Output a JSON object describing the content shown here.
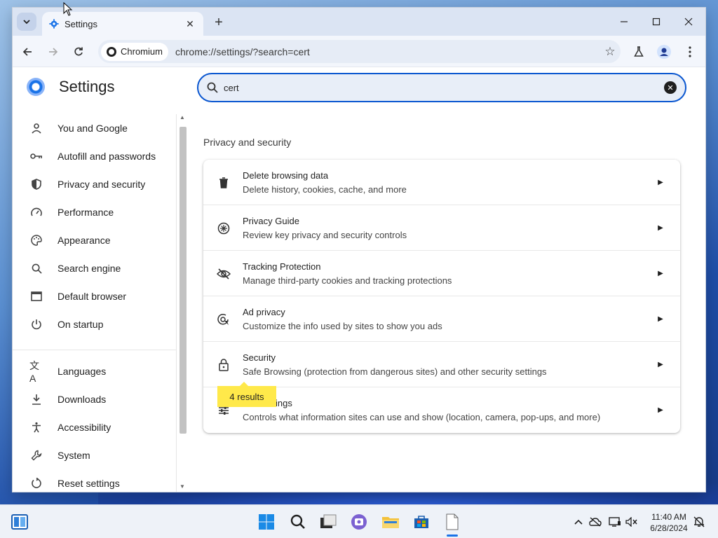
{
  "browser": {
    "tab_title": "Settings",
    "chip_label": "Chromium",
    "url": "chrome://settings/?search=cert"
  },
  "settings": {
    "title": "Settings",
    "search_value": "cert",
    "section_title": "Privacy and security",
    "results_badge": "4 results",
    "nav": [
      {
        "label": "You and Google",
        "icon": "person-icon"
      },
      {
        "label": "Autofill and passwords",
        "icon": "key-icon"
      },
      {
        "label": "Privacy and security",
        "icon": "shield-icon"
      },
      {
        "label": "Performance",
        "icon": "speedometer-icon"
      },
      {
        "label": "Appearance",
        "icon": "palette-icon"
      },
      {
        "label": "Search engine",
        "icon": "search-icon"
      },
      {
        "label": "Default browser",
        "icon": "browser-window-icon"
      },
      {
        "label": "On startup",
        "icon": "power-icon"
      },
      {
        "label": "Languages",
        "icon": "translate-icon"
      },
      {
        "label": "Downloads",
        "icon": "download-icon"
      },
      {
        "label": "Accessibility",
        "icon": "accessibility-icon"
      },
      {
        "label": "System",
        "icon": "wrench-icon"
      },
      {
        "label": "Reset settings",
        "icon": "reset-icon"
      }
    ],
    "rows": [
      {
        "title": "Delete browsing data",
        "desc": "Delete history, cookies, cache, and more",
        "icon": "trash-icon"
      },
      {
        "title": "Privacy Guide",
        "desc": "Review key privacy and security controls",
        "icon": "compass-icon"
      },
      {
        "title": "Tracking Protection",
        "desc": "Manage third-party cookies and tracking protections",
        "icon": "eye-off-icon"
      },
      {
        "title": "Ad privacy",
        "desc": "Customize the info used by sites to show you ads",
        "icon": "ad-privacy-icon"
      },
      {
        "title": "Security",
        "desc": "Safe Browsing (protection from dangerous sites) and other security settings",
        "icon": "lock-icon"
      },
      {
        "title": "Site settings",
        "desc": "Controls what information sites can use and show (location, camera, pop-ups, and more)",
        "icon": "sliders-icon"
      }
    ]
  },
  "taskbar": {
    "time": "11:40 AM",
    "date": "6/28/2024"
  },
  "colors": {
    "accent": "#0b57d0",
    "highlight": "#ffe94a"
  }
}
